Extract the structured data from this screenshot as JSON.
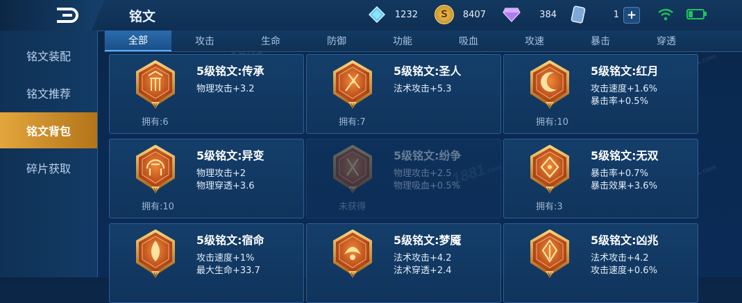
{
  "header": {
    "title": "铭文",
    "resources": [
      {
        "icon": "diamond-icon",
        "value": "1232"
      },
      {
        "icon": "coin-icon",
        "value": "8407"
      },
      {
        "icon": "gem-icon",
        "value": "384"
      },
      {
        "icon": "card-icon",
        "value": "1"
      }
    ]
  },
  "sidebar": {
    "items": [
      {
        "label": "铭文装配"
      },
      {
        "label": "铭文推荐"
      },
      {
        "label": "铭文背包"
      },
      {
        "label": "碎片获取"
      }
    ]
  },
  "tabs": [
    {
      "label": "全部"
    },
    {
      "label": "攻击"
    },
    {
      "label": "生命"
    },
    {
      "label": "防御"
    },
    {
      "label": "功能"
    },
    {
      "label": "吸血"
    },
    {
      "label": "攻速"
    },
    {
      "label": "暴击"
    },
    {
      "label": "穿透"
    }
  ],
  "cards": [
    {
      "name": "5级铭文:传承",
      "stats": [
        "物理攻击+3.2"
      ],
      "owned": "拥有:6"
    },
    {
      "name": "5级铭文:圣人",
      "stats": [
        "法术攻击+5.3"
      ],
      "owned": "拥有:7"
    },
    {
      "name": "5级铭文:红月",
      "stats": [
        "攻击速度+1.6%",
        "暴击率+0.5%"
      ],
      "owned": "拥有:10"
    },
    {
      "name": "5级铭文:异变",
      "stats": [
        "物理攻击+2",
        "物理穿透+3.6"
      ],
      "owned": "拥有:10"
    },
    {
      "name": "5级铭文:纷争",
      "stats": [
        "物理攻击+2.5",
        "物理吸血+0.5%"
      ],
      "owned": "未获得"
    },
    {
      "name": "5级铭文:无双",
      "stats": [
        "暴击率+0.7%",
        "暴击效果+3.6%"
      ],
      "owned": "拥有:3"
    },
    {
      "name": "5级铭文:宿命",
      "stats": [
        "攻击速度+1%",
        "最大生命+33.7"
      ],
      "owned": ""
    },
    {
      "name": "5级铭文:梦魇",
      "stats": [
        "法术攻击+4.2",
        "法术穿透+2.4"
      ],
      "owned": ""
    },
    {
      "name": "5级铭文:凶兆",
      "stats": [
        "法术攻击+4.2",
        "攻击速度+0.6%"
      ],
      "owned": ""
    }
  ],
  "colors": {
    "accent_active": "#e3a63c",
    "tab_active": "#2b6cae",
    "card_border": "#2d5f94",
    "emblem": "#d8742c"
  }
}
